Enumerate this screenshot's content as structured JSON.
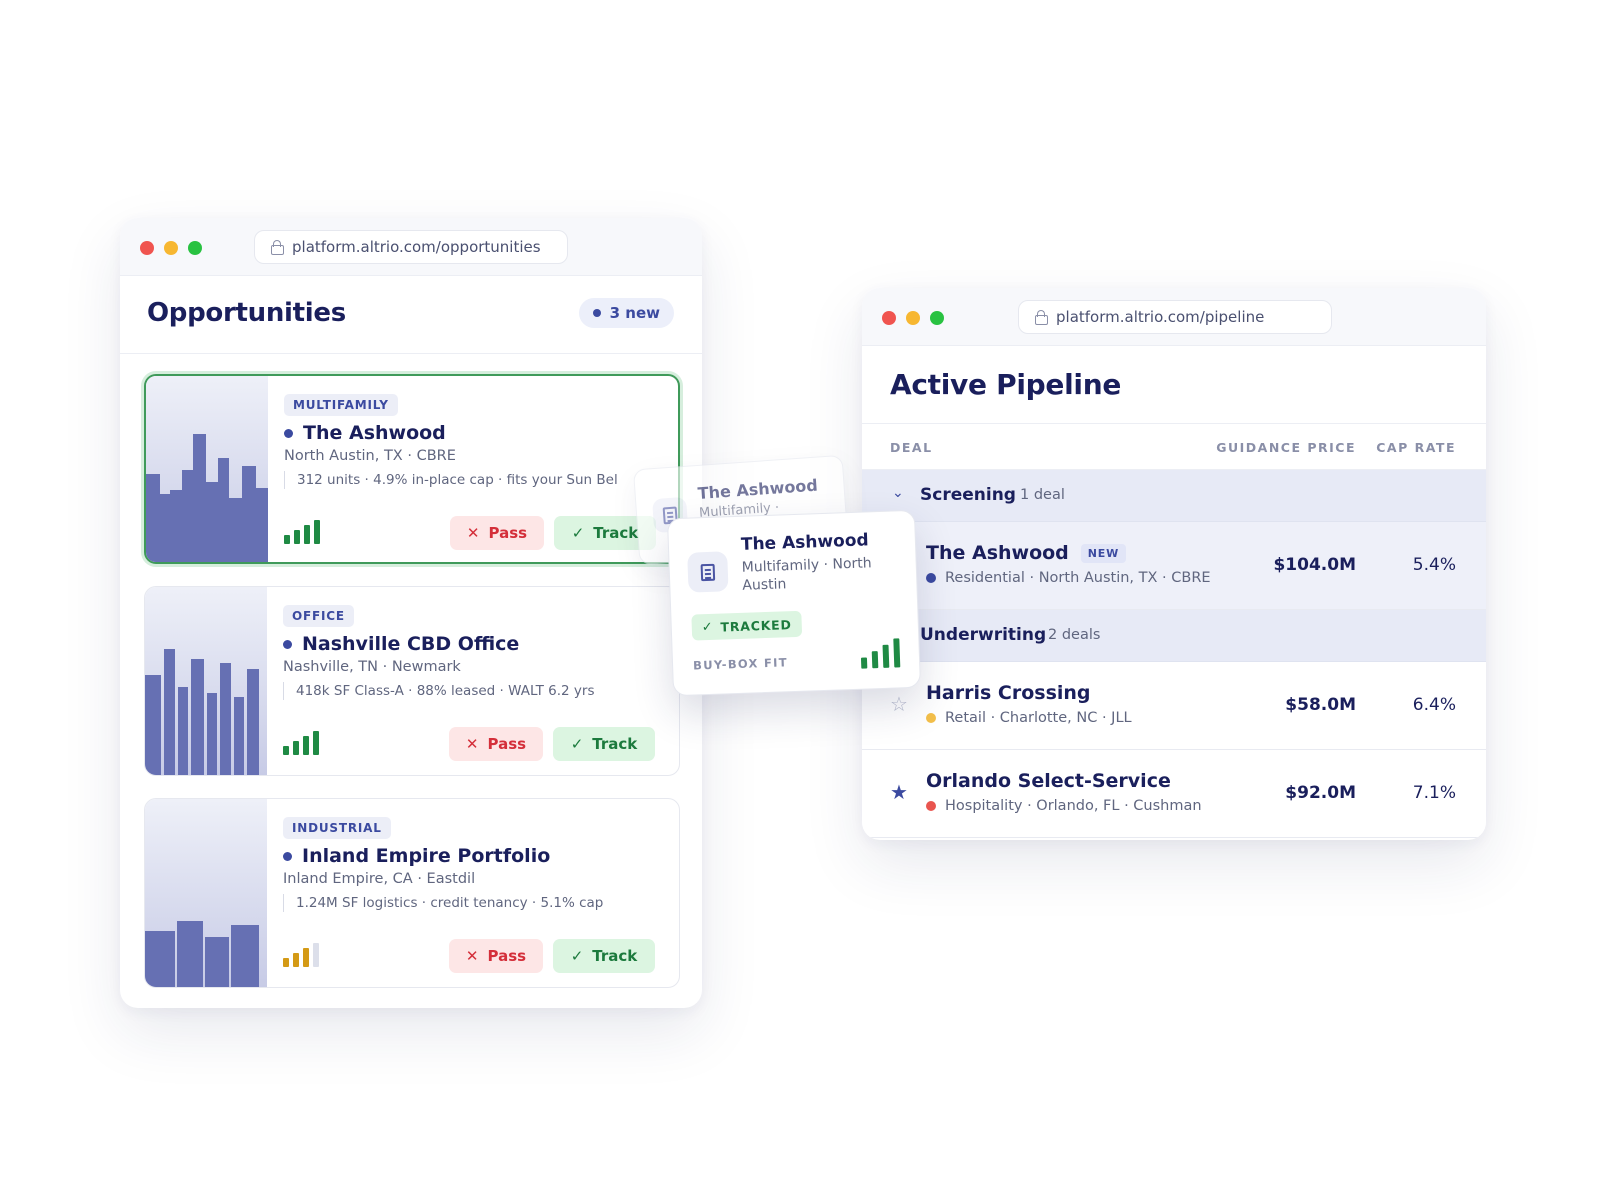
{
  "opportunities_window": {
    "url": "platform.altrio.com/opportunities",
    "title": "Opportunities",
    "new_count_label": "3 new",
    "cards": [
      {
        "type": "MULTIFAMILY",
        "name": "The Ashwood",
        "location": "North Austin, TX · CBRE",
        "meta": "312 units · 4.9% in-place cap · fits your Sun Bel",
        "signal_level": 4,
        "signal_color": "#1f8a44",
        "pass_label": "Pass",
        "track_label": "Track",
        "selected": true
      },
      {
        "type": "OFFICE",
        "name": "Nashville CBD Office",
        "location": "Nashville, TN · Newmark",
        "meta": "418k SF Class-A · 88% leased · WALT 6.2 yrs",
        "signal_level": 4,
        "signal_color": "#1f8a44",
        "pass_label": "Pass",
        "track_label": "Track"
      },
      {
        "type": "INDUSTRIAL",
        "name": "Inland Empire Portfolio",
        "location": "Inland Empire, CA · Eastdil",
        "meta": "1.24M SF logistics · credit tenancy · 5.1% cap",
        "signal_level": 3,
        "signal_color": "#d49a16",
        "pass_label": "Pass",
        "track_label": "Track"
      }
    ]
  },
  "drag_preview": {
    "ghost_title": "The Ashwood",
    "ghost_subtitle": "Multifamily ·",
    "title": "The Ashwood",
    "subtitle": "Multifamily · North Austin",
    "status": "TRACKED",
    "fit_label": "BUY-BOX FIT",
    "signal_level": 4
  },
  "pipeline_window": {
    "url": "platform.altrio.com/pipeline",
    "title": "Active Pipeline",
    "columns": {
      "deal": "DEAL",
      "price": "GUIDANCE PRICE",
      "cap": "CAP RATE"
    },
    "groups": [
      {
        "name": "Screening",
        "count": "1 deal",
        "deals": [
          {
            "name": "The Ashwood",
            "tag": "NEW",
            "sub": "Residential · North Austin, TX · CBRE",
            "dot_color": "#3b4aa0",
            "price": "$104.0M",
            "cap": "5.4%"
          }
        ]
      },
      {
        "name": "Underwriting",
        "count": "2 deals",
        "deals": [
          {
            "name": "Harris Crossing",
            "sub": "Retail · Charlotte, NC · JLL",
            "dot_color": "#f4c04a",
            "price": "$58.0M",
            "cap": "6.4%",
            "starred": false
          },
          {
            "name": "Orlando Select-Service",
            "sub": "Hospitality · Orlando, FL · Cushman",
            "dot_color": "#e9554f",
            "price": "$92.0M",
            "cap": "7.1%",
            "starred": true
          }
        ]
      }
    ]
  },
  "icons": {
    "star_empty": "☆",
    "star_filled": "★",
    "chevron_down": "⌄",
    "x": "✕",
    "check": "✓"
  }
}
